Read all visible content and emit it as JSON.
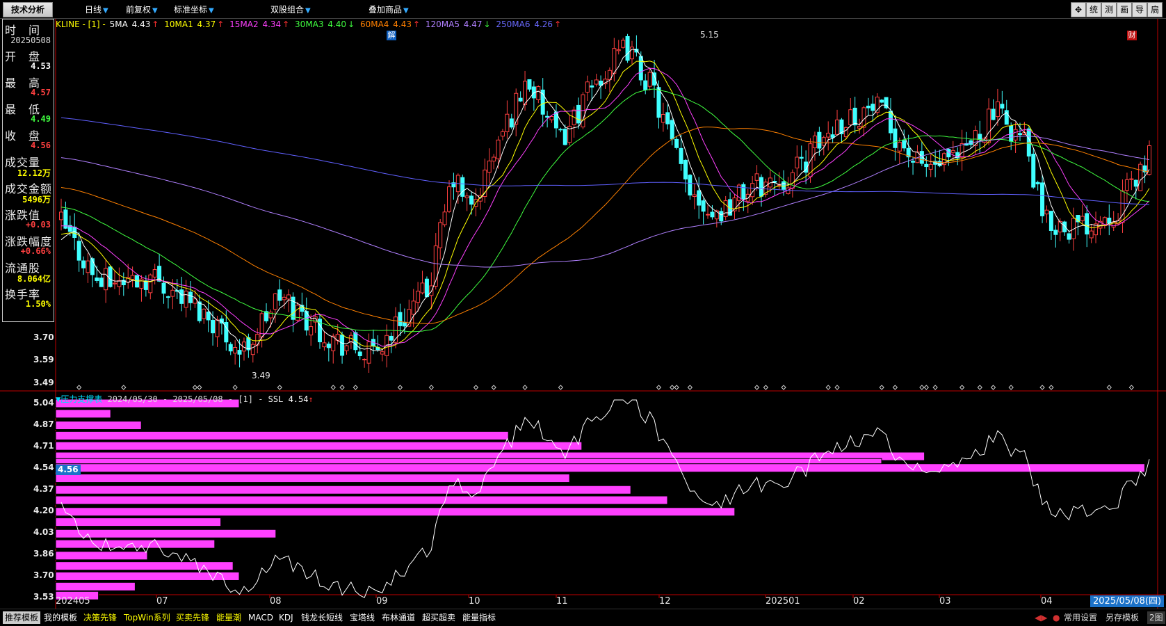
{
  "topbar": {
    "active_tab": "技术分析",
    "menus": [
      {
        "label": "日线"
      },
      {
        "label": "前复权"
      },
      {
        "label": "标准坐标"
      },
      {
        "label": "双股组合"
      },
      {
        "label": "叠加商品"
      }
    ],
    "right_buttons": [
      "统",
      "测",
      "画",
      "导",
      "扃"
    ]
  },
  "info_panel": {
    "time_label": "时　间",
    "date": "20250508",
    "open_label": "开　盘",
    "open": "4.53",
    "high_label": "最　高",
    "high": "4.57",
    "low_label": "最　低",
    "low": "4.49",
    "close_label": "收　盘",
    "close": "4.56",
    "volume_label": "成交量",
    "volume": "12.12万",
    "amount_label": "成交金额",
    "amount": "5496万",
    "change_label": "涨跌值",
    "change": "+0.03",
    "change_pct_label": "涨跌幅度",
    "change_pct": "+0.66%",
    "float_label": "流通股",
    "float": "8.064亿",
    "turnover_label": "换手率",
    "turnover": "1.50%"
  },
  "ma_bar": {
    "prefix": "KLINE - [1] -",
    "items": [
      {
        "name": "5MA",
        "value": "4.43",
        "arrow": "↑",
        "color": "#ffffff"
      },
      {
        "name": "10MA1",
        "value": "4.37",
        "arrow": "↑",
        "color": "#ffff00"
      },
      {
        "name": "15MA2",
        "value": "4.34",
        "arrow": "↑",
        "color": "#ff40ff"
      },
      {
        "name": "30MA3",
        "value": "4.40",
        "arrow": "↓",
        "color": "#40ff40"
      },
      {
        "name": "60MA4",
        "value": "4.43",
        "arrow": "↑",
        "color": "#ff8000"
      },
      {
        "name": "120MA5",
        "value": "4.47",
        "arrow": "↓",
        "color": "#b080ff"
      },
      {
        "name": "250MA6",
        "value": "4.26",
        "arrow": "↑",
        "color": "#6060ff"
      }
    ]
  },
  "main_axis": [
    "3.70",
    "3.59",
    "3.49"
  ],
  "annotations": {
    "high": "5.15",
    "low": "3.49",
    "jie": "解",
    "cai": "财"
  },
  "ss_bar": {
    "title": "▼压力支撑表",
    "range": "2024/05/30 - 2025/05/08 - [1] -",
    "ssl": "SSL 4.54",
    "arrow": "↑"
  },
  "ss_axis": [
    "5.04",
    "4.87",
    "4.71",
    "4.54",
    "4.37",
    "4.20",
    "4.03",
    "3.86",
    "3.70",
    "3.53"
  ],
  "current_price": "4.56",
  "chart_data": {
    "type": "candlestick",
    "x_labels": [
      "202405",
      "07",
      "08",
      "09",
      "10",
      "11",
      "12",
      "202501",
      "02",
      "03",
      "04"
    ],
    "last_date": "2025/05/08(四)",
    "price_low": 3.49,
    "price_high": 5.15,
    "volume_profile": [
      {
        "price": 5.04,
        "weight": 0.3
      },
      {
        "price": 4.96,
        "weight": 0.09
      },
      {
        "price": 4.87,
        "weight": 0.14
      },
      {
        "price": 4.79,
        "weight": 0.74
      },
      {
        "price": 4.71,
        "weight": 0.86
      },
      {
        "price": 4.63,
        "weight": 1.42
      },
      {
        "price": 4.58,
        "weight": 1.35
      },
      {
        "price": 4.54,
        "weight": 1.78
      },
      {
        "price": 4.46,
        "weight": 0.84
      },
      {
        "price": 4.37,
        "weight": 0.94
      },
      {
        "price": 4.29,
        "weight": 1.0
      },
      {
        "price": 4.2,
        "weight": 1.11
      },
      {
        "price": 4.12,
        "weight": 0.27
      },
      {
        "price": 4.03,
        "weight": 0.36
      },
      {
        "price": 3.95,
        "weight": 0.26
      },
      {
        "price": 3.86,
        "weight": 0.15
      },
      {
        "price": 3.78,
        "weight": 0.29
      },
      {
        "price": 3.7,
        "weight": 0.3
      },
      {
        "price": 3.62,
        "weight": 0.13
      },
      {
        "price": 3.55,
        "weight": 0.07
      }
    ]
  },
  "bottom_tabs": [
    {
      "label": "推荐模板",
      "color": "#000000",
      "active": true
    },
    {
      "label": "我的模板",
      "color": "#ffffff"
    },
    {
      "label": "决策先锋",
      "color": "#ffff00"
    },
    {
      "label": "TopWin系列",
      "color": "#ffff00"
    },
    {
      "label": "买卖先锋",
      "color": "#ffff00"
    },
    {
      "label": "能量潮",
      "color": "#ffff00"
    },
    {
      "label": "MACD",
      "color": "#ffffff"
    },
    {
      "label": "KDJ",
      "color": "#ffffff"
    },
    {
      "label": "钱龙长短线",
      "color": "#ffffff"
    },
    {
      "label": "宝塔线",
      "color": "#ffffff"
    },
    {
      "label": "布林通道",
      "color": "#ffffff"
    },
    {
      "label": "超买超卖",
      "color": "#ffffff"
    },
    {
      "label": "能量指标",
      "color": "#ffffff"
    }
  ],
  "bottom_right": {
    "settings": "常用设置",
    "save": "另存模板",
    "view": "2图"
  },
  "colors": {
    "up": "#ff4040",
    "down": "#40ffff",
    "profile": "#ff40ff",
    "axis": "#c00000"
  }
}
